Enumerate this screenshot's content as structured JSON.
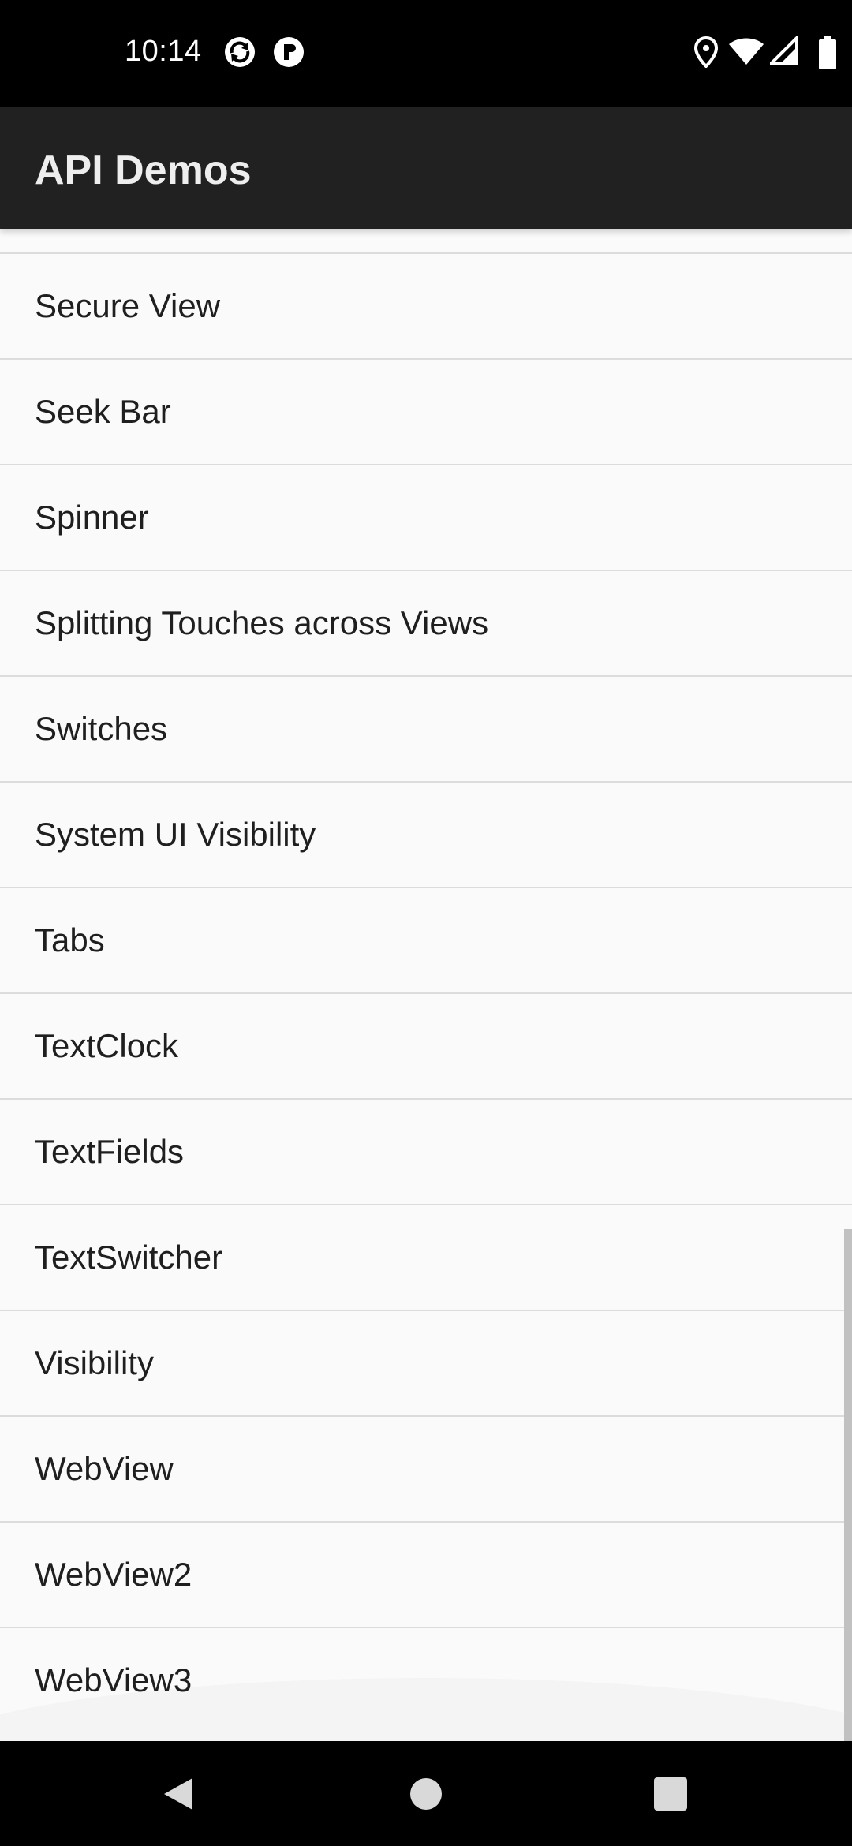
{
  "status_bar": {
    "time": "10:14",
    "left_icons": [
      "sync-icon",
      "app-notification-icon"
    ],
    "right_icons": [
      "location-icon",
      "wifi-icon",
      "cell-signal-icon",
      "battery-icon"
    ]
  },
  "app_bar": {
    "title": "API Demos"
  },
  "list": {
    "items": [
      {
        "label": "Secure View"
      },
      {
        "label": "Seek Bar"
      },
      {
        "label": "Spinner"
      },
      {
        "label": "Splitting Touches across Views"
      },
      {
        "label": "Switches"
      },
      {
        "label": "System UI Visibility"
      },
      {
        "label": "Tabs"
      },
      {
        "label": "TextClock"
      },
      {
        "label": "TextFields"
      },
      {
        "label": "TextSwitcher"
      },
      {
        "label": "Visibility"
      },
      {
        "label": "WebView"
      },
      {
        "label": "WebView2"
      },
      {
        "label": "WebView3"
      }
    ]
  },
  "nav_bar": {
    "buttons": [
      "back-icon",
      "home-icon",
      "recents-icon"
    ]
  },
  "colors": {
    "status_bar_bg": "#000000",
    "app_bar_bg": "#212121",
    "list_bg": "#fafafa",
    "divider": "#dcdcdc",
    "text": "#1f1f1f"
  }
}
